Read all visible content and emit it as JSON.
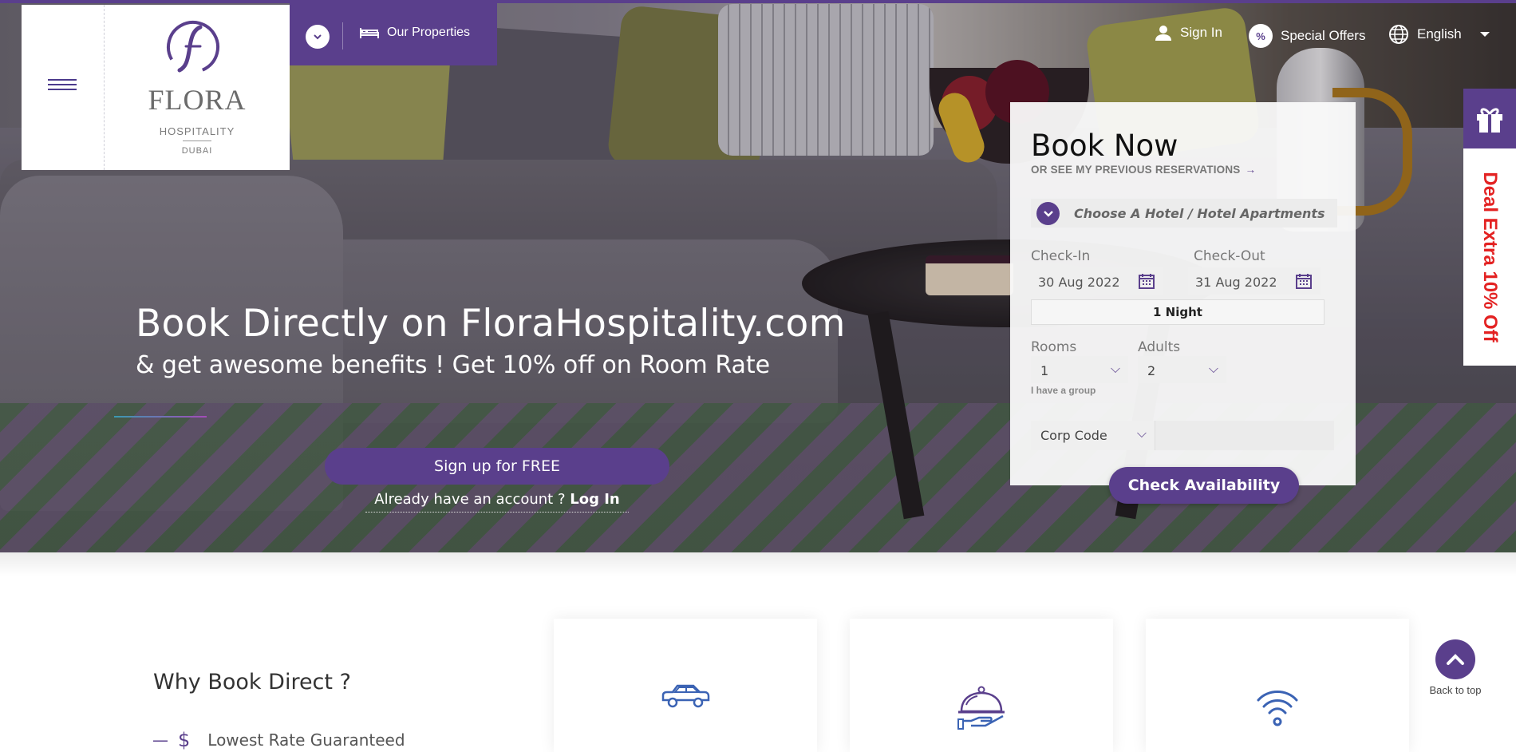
{
  "brand": {
    "name": "FLORA",
    "sub": "HOSPITALITY",
    "location": "DUBAI",
    "accent": "#5a3f8c"
  },
  "header": {
    "properties_label": "Our Properties",
    "signin_label": "Sign In",
    "offers_label": "Special Offers",
    "offers_badge": "%",
    "language_label": "English"
  },
  "hero": {
    "title": "Book Directly on FloraHospitality.com",
    "subtitle": "& get awesome benefits ! Get 10% off on Room Rate",
    "signup_label": "Sign up for FREE",
    "already_text": "Already have an account ?",
    "login_label": "Log In"
  },
  "booking": {
    "title": "Book Now",
    "previous_link": "OR SEE MY PREVIOUS RESERVATIONS",
    "hotel_placeholder": "Choose A Hotel / Hotel Apartments",
    "checkin_label": "Check-In",
    "checkin_value": "30 Aug 2022",
    "checkout_label": "Check-Out",
    "checkout_value": "31 Aug 2022",
    "nights": "1 Night",
    "rooms_label": "Rooms",
    "rooms_value": "1",
    "adults_label": "Adults",
    "adults_value": "2",
    "group_link": "I have a group",
    "corp_label": "Corp Code",
    "corp_value": "",
    "submit_label": "Check Availability"
  },
  "deal": {
    "label": "Deal Extra 10% Off",
    "color": "#e32222"
  },
  "why": {
    "title": "Why Book Direct ?",
    "items": [
      {
        "icon": "dollar-icon",
        "label": "Lowest Rate Guaranteed"
      }
    ],
    "cards": [
      {
        "icon": "car-icon"
      },
      {
        "icon": "room-service-icon"
      },
      {
        "icon": "wifi-icon"
      }
    ]
  },
  "back_to_top": "Back to top"
}
